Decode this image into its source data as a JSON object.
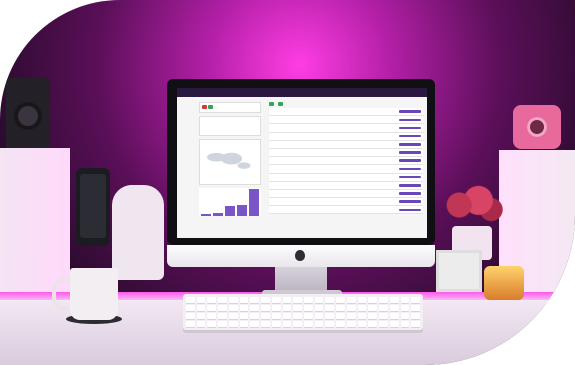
{
  "scene": {
    "description_items": [
      "desk",
      "monitor",
      "keyboard",
      "mug",
      "phone",
      "speaker",
      "camera",
      "flowers",
      "candle",
      "photo-frame"
    ]
  },
  "screen": {
    "rows": 13,
    "bar_levels": [
      0.08,
      0.12,
      0.35,
      0.4,
      0.95
    ]
  },
  "colors": {
    "ambient_glow": "#ff3de4",
    "topbar": "#2b1840",
    "accent_purple": "#6a47b8",
    "button_red": "#dd3333",
    "button_green": "#33a55a"
  }
}
